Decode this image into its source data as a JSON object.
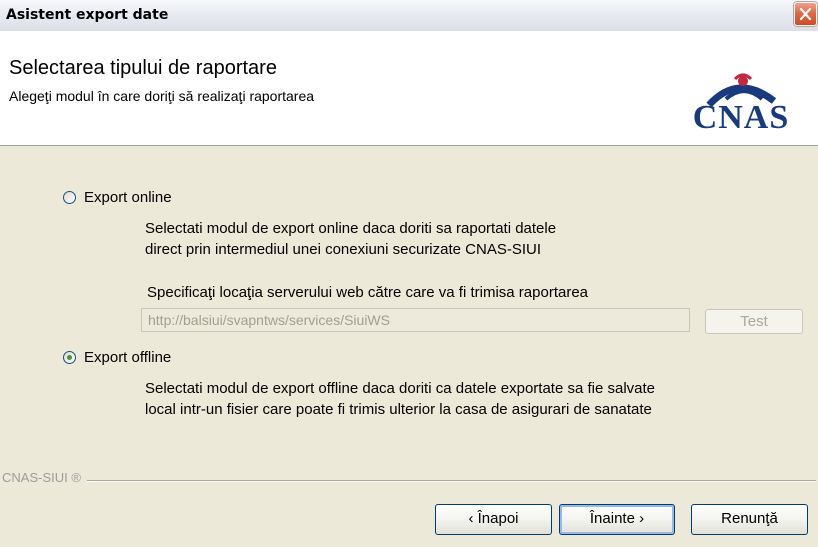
{
  "window": {
    "title": "Asistent export date"
  },
  "header": {
    "title": "Selectarea tipului de raportare",
    "subtitle": "Alegeţi modul în care doriţi să realizaţi raportarea",
    "logo_text": "CNAS"
  },
  "options": {
    "online": {
      "label": "Export online",
      "selected": false,
      "desc_line1": "Selectati modul de export online daca doriti sa raportati datele",
      "desc_line2": "direct prin intermediul unei conexiuni securizate CNAS-SIUI",
      "server_label": "Specificaţi locaţia serverului web către care va fi trimisa raportarea",
      "server_url": "http://balsiui/svapntws/services/SiuiWS",
      "test_label": "Test"
    },
    "offline": {
      "label": "Export offline",
      "selected": true,
      "desc_line1": "Selectati modul de export offline daca doriti ca datele exportate sa fie salvate",
      "desc_line2": "local intr-un fisier care poate fi trimis ulterior la casa de asigurari de sanatate"
    }
  },
  "footer": {
    "brand": "CNAS-SIUI ®",
    "back_label": "‹ Înapoi",
    "next_label": "Înainte ›",
    "cancel_label": "Renunţă"
  }
}
